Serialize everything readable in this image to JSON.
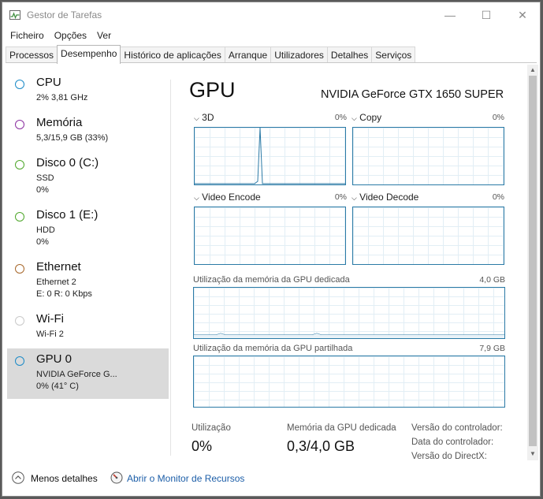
{
  "window": {
    "title": "Gestor de Tarefas",
    "minimize": "—",
    "maximize": "☐",
    "close": "✕"
  },
  "menu": [
    "Ficheiro",
    "Opções",
    "Ver"
  ],
  "tabs": [
    "Processos",
    "Desempenho",
    "Histórico de aplicações",
    "Arranque",
    "Utilizadores",
    "Detalhes",
    "Serviços"
  ],
  "active_tab": "Desempenho",
  "sidebar": {
    "items": [
      {
        "name": "CPU",
        "sub1": "2% 3,81 GHz",
        "sub2": "",
        "color": "#1b8ac7"
      },
      {
        "name": "Memória",
        "sub1": "5,3/15,9 GB (33%)",
        "sub2": "",
        "color": "#8b2fa0"
      },
      {
        "name": "Disco 0 (C:)",
        "sub1": "SSD",
        "sub2": "0%",
        "color": "#4ea72a"
      },
      {
        "name": "Disco 1 (E:)",
        "sub1": "HDD",
        "sub2": "0%",
        "color": "#4ea72a"
      },
      {
        "name": "Ethernet",
        "sub1": "Ethernet 2",
        "sub2": "E: 0 R: 0 Kbps",
        "color": "#a7672a"
      },
      {
        "name": "Wi-Fi",
        "sub1": "Wi-Fi 2",
        "sub2": "",
        "color": "#c9c9c9"
      },
      {
        "name": "GPU 0",
        "sub1": "NVIDIA GeForce G...",
        "sub2": "0% (41° C)",
        "color": "#1b8ac7"
      }
    ]
  },
  "main": {
    "title": "GPU",
    "device": "NVIDIA GeForce GTX 1650 SUPER",
    "graphs": [
      {
        "label": "3D",
        "value": "0%"
      },
      {
        "label": "Copy",
        "value": "0%"
      },
      {
        "label": "Video Encode",
        "value": "0%"
      },
      {
        "label": "Video Decode",
        "value": "0%"
      }
    ],
    "dedicated_label": "Utilização da memória da GPU dedicada",
    "dedicated_value": "4,0 GB",
    "shared_label": "Utilização da memória da GPU partilhada",
    "shared_value": "7,9 GB",
    "stats": {
      "utilization_label": "Utilização",
      "utilization_value": "0%",
      "dedicated_mem_label": "Memória da GPU dedicada",
      "dedicated_mem_value": "0,3/4,0 GB",
      "driver_version_label": "Versão do controlador:",
      "driver_date_label": "Data do controlador:",
      "directx_label": "Versão do DirectX:"
    }
  },
  "footer": {
    "fewer_details": "Menos detalhes",
    "open_monitor": "Abrir o Monitor de Recursos"
  },
  "colors": {
    "graph_border": "#2b7aa6",
    "graph_grid": "#e2eef5",
    "link": "#1c5ea8",
    "selected_bg": "#dadada"
  }
}
